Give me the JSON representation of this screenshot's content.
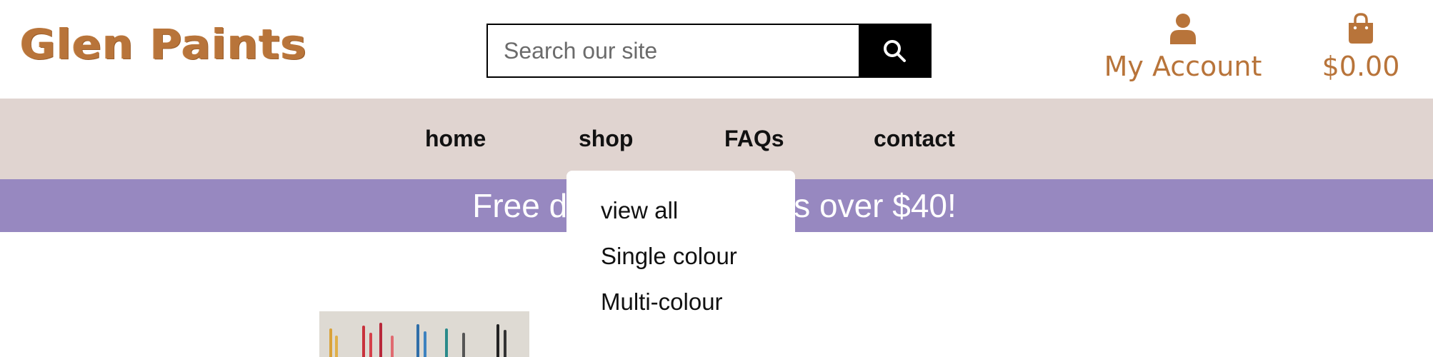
{
  "header": {
    "logo_text": "Glen Paints",
    "search": {
      "placeholder": "Search our site",
      "value": ""
    },
    "account": {
      "label": "My Account",
      "icon": "user-icon"
    },
    "cart": {
      "label": "$0.00",
      "icon": "shopping-bag-icon"
    }
  },
  "nav": {
    "items": [
      {
        "label": "home"
      },
      {
        "label": "shop"
      },
      {
        "label": "FAQs"
      },
      {
        "label": "contact"
      }
    ]
  },
  "shop_dropdown": {
    "items": [
      {
        "label": "view all"
      },
      {
        "label": "Single colour"
      },
      {
        "label": "Multi-colour"
      }
    ]
  },
  "banner": {
    "text": "Free delivery on orders over $40!"
  },
  "colors": {
    "brand": "#b8743a",
    "nav_bg": "#e0d4d0",
    "banner_bg": "#9788c0",
    "search_button": "#000000"
  }
}
